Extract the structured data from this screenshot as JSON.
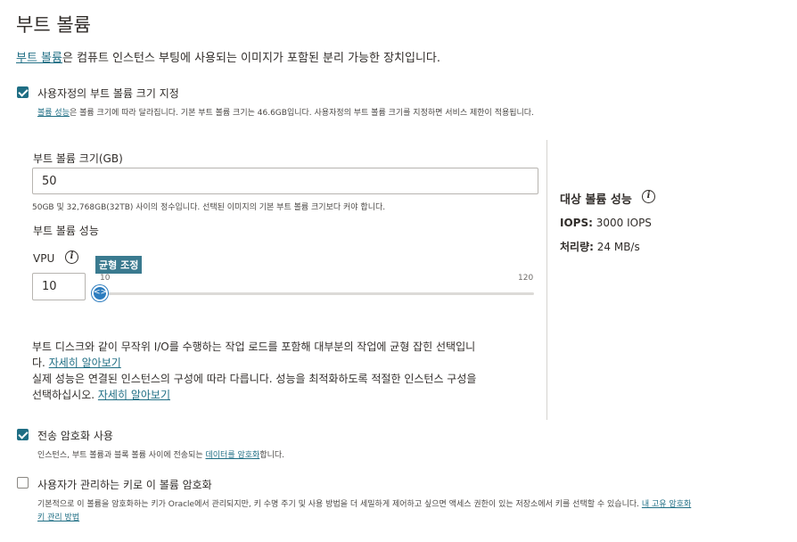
{
  "header": {
    "title": "부트 볼륨"
  },
  "intro": {
    "link": "부트 볼륨",
    "text": "은 컴퓨트 인스턴스 부팅에 사용되는 이미지가 포함된 분리 가능한 장치입니다."
  },
  "custom_size": {
    "checked": true,
    "label": "사용자정의 부트 볼륨 크기 지정",
    "hint_link": "볼륨 성능",
    "hint_text": "은 볼륨 크기에 따라 달라집니다. 기본 부트 볼륨 크기는 46.6GB입니다. 사용자정의 부트 볼륨 크기를 지정하면 서비스 제한이 적용됩니다."
  },
  "size_field": {
    "label": "부트 볼륨 크기(GB)",
    "value": "50",
    "hint": "50GB 및 32,768GB(32TB) 사이의 정수입니다. 선택된 이미지의 기본 부트 볼륨 크기보다 커야 합니다."
  },
  "performance": {
    "label": "부트 볼륨 성능",
    "vpu_label": "VPU",
    "vpu_value": "10",
    "slider_tooltip": "균형 조정",
    "slider_min": "10",
    "slider_max": "120",
    "slider_value": 10,
    "desc1": "부트 디스크와 같이 무작위 I/O를 수행하는 작업 로드를 포함해 대부분의 작업에 균형 잡힌 선택입니",
    "desc1b": "다.",
    "desc1_link": "자세히 알아보기",
    "desc2": "실제 성능은 연결된 인스턴스의 구성에 따라 다릅니다. 성능을 최적화하도록 적절한 인스턴스 구성을",
    "desc2b": "선택하십시오.",
    "desc2_link": "자세히 알아보기"
  },
  "target_perf": {
    "title": "대상 볼륨 성능",
    "iops_label": "IOPS:",
    "iops_value": "3000 IOPS",
    "throughput_label": "처리량:",
    "throughput_value": "24 MB/s"
  },
  "in_transit": {
    "checked": true,
    "label": "전송 암호화 사용",
    "hint_text": "인스턴스, 부트 볼륨과 블록 볼륨 사이에 전송되는 ",
    "hint_link": "데이터를 암호화",
    "hint_after": "합니다."
  },
  "customer_key": {
    "checked": false,
    "label": "사용자가 관리하는 키로 이 볼륨 암호화",
    "hint_text": "기본적으로 이 볼륨을 암호화하는 키가 Oracle에서 관리되지만, 키 수명 주기 및 사용 방법을 더 세밀하게 제어하고 싶으면 액세스 권한이 있는 저장소에서 키를 선택할 수 있습니다.",
    "hint_link": "내 고유 암호화",
    "hint_link2": "키 관리 방법"
  },
  "colors": {
    "accent": "#1f6e84",
    "slider": "#2d7dbf",
    "tooltip": "#3a7a8f"
  }
}
